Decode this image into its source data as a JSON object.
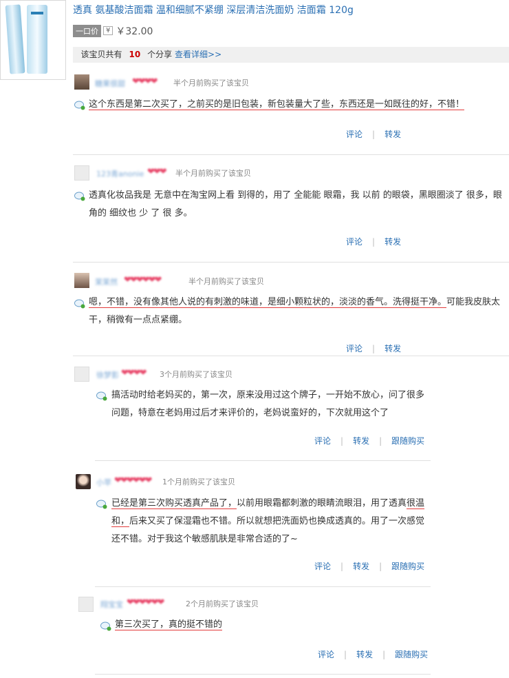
{
  "product": {
    "title": "透真 氨基酸洁面霜 温和细腻不紧绷 深层清洁洗面奶 洁面霜 120g",
    "price_label": "一口价",
    "yen": "¥",
    "price": "￥32.00"
  },
  "share_bar": {
    "prefix": "该宝贝共有",
    "count": "10",
    "suffix": "个分享",
    "link": "查看详细>>"
  },
  "reviews": [
    {
      "username": "糖果很甜",
      "hearts": "❤❤❤❤",
      "time": "半个月前购买了该宝贝",
      "text_underlined": "这个东西是第二次买了，之前买的是旧包装，新包装量大了些，东西还是一如既往的好，不错！",
      "text_rest": "",
      "actions": [
        "评论",
        "转发"
      ]
    },
    {
      "username": "123青anonie",
      "hearts": "❤❤❤",
      "time": "半个月前购买了该宝贝",
      "text_underlined": "",
      "text_rest": "透真化妆品我是 无意中在淘宝网上看 到得的，用了 全能能 眼霜，我 以前 的眼袋，黑眼圈淡了 很多，眼角的 细纹也 少 了 很 多。",
      "actions": [
        "评论",
        "转发"
      ]
    },
    {
      "username": "茉茉然",
      "hearts": "❤❤❤❤❤❤",
      "time": "半个月前购买了该宝贝",
      "text_underlined": "嗯，不错，没有像其他人说的有刺激的味道，是细小颗粒状的，淡淡的香气。洗得挺干净。",
      "text_rest": "可能我皮肤太干，稍微有一点点紧绷。",
      "actions": [
        "评论",
        "转发"
      ]
    },
    {
      "username": "徐梦影",
      "hearts": "❤❤❤❤",
      "time": "3个月前购买了该宝贝",
      "text_underlined": "",
      "text_rest": "搞活动时给老妈买的，第一次，原来没用过这个牌子，一开始不放心，问了很多问题，特意在老妈用过后才来评价的，老妈说蛮好的，下次就用这个了",
      "actions": [
        "评论",
        "转发",
        "跟随购买"
      ]
    },
    {
      "username": "小苹",
      "hearts": "❤❤❤❤❤❤",
      "time": "1个月前购买了该宝贝",
      "text_underlined_1": "已经是第三次购买透真产品了，",
      "text_mid_1": "以前用眼霜都刺激的眼睛流眼泪，用了透真",
      "text_underlined_2": "很温和，",
      "text_mid_2": "后来又买了保湿霜也不错。所以就想把洗面奶也换成透真的。用了一次感觉还不错。对于我这个敏感肌肤是非常合适的了~",
      "actions": [
        "评论",
        "转发",
        "跟随购买"
      ]
    },
    {
      "username": "翔宝宝",
      "hearts": "❤❤❤❤❤❤",
      "time": "2个月前购买了该宝贝",
      "text_underlined": "第三次买了，真的挺不错的",
      "text_rest": "",
      "actions": [
        "评论",
        "转发",
        "跟随购买"
      ]
    }
  ]
}
